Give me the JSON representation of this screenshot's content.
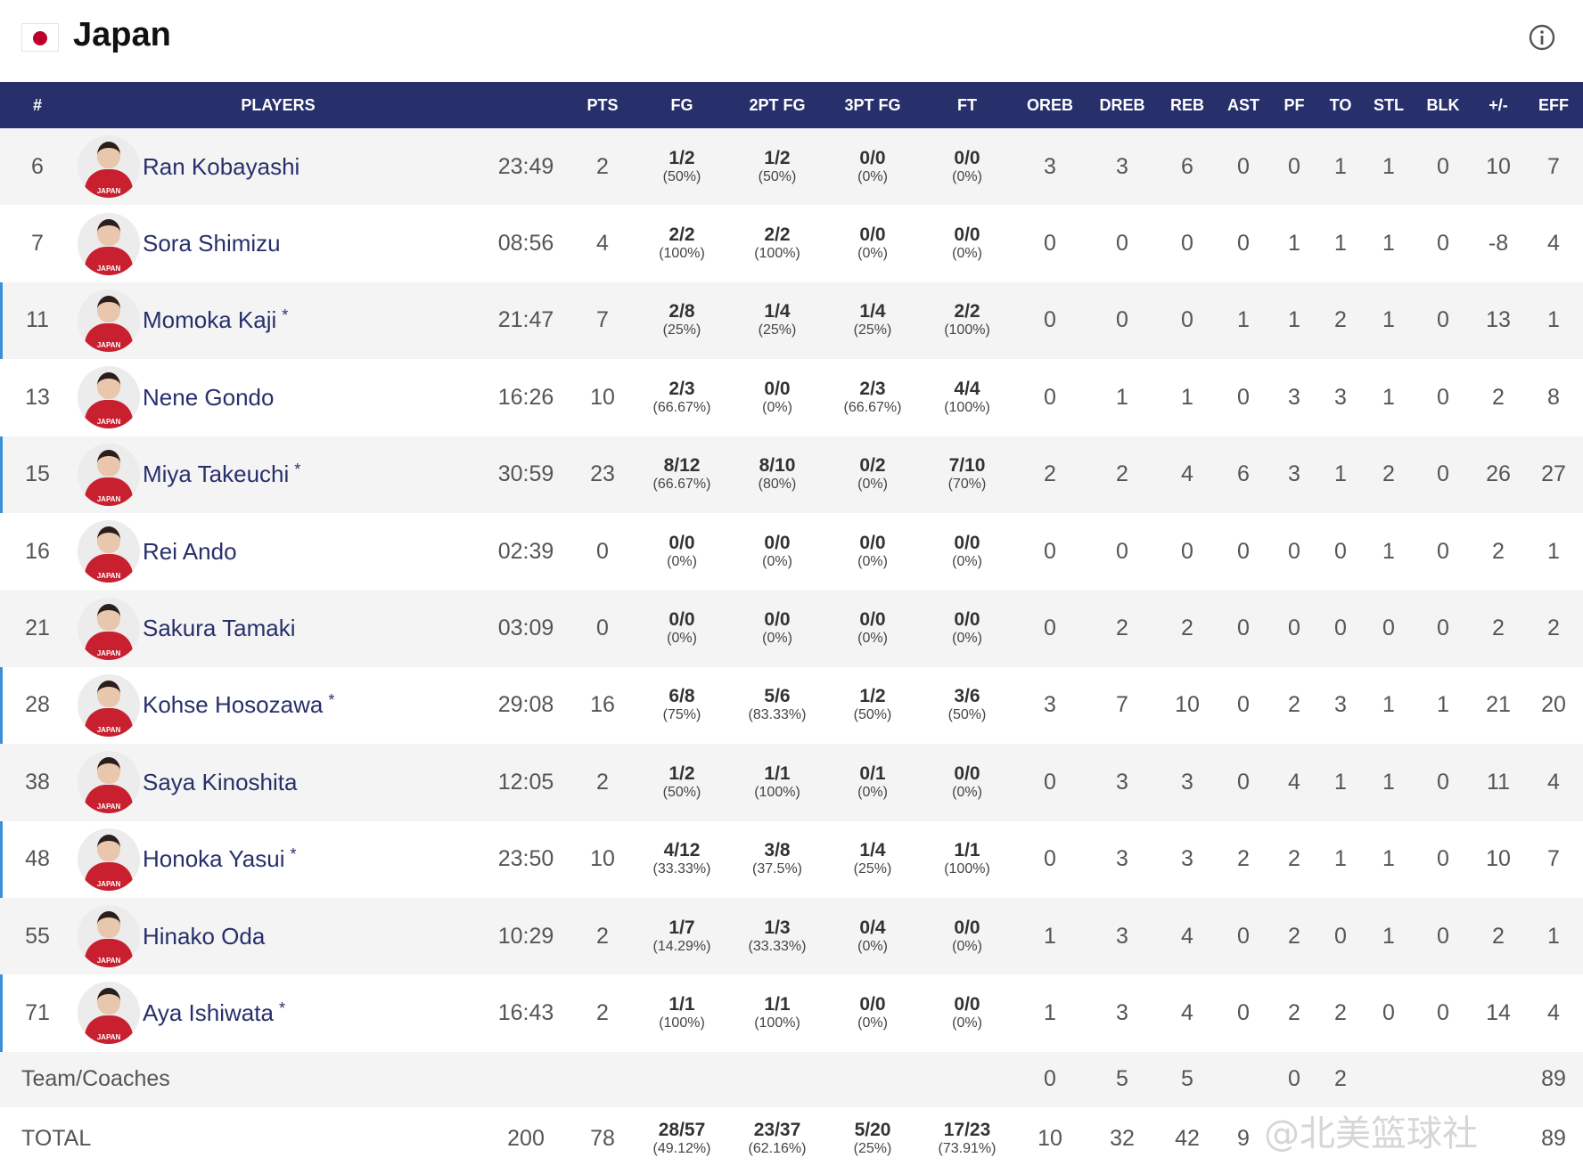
{
  "team": {
    "name": "Japan"
  },
  "header": [
    "#",
    "PLAYERS",
    "PTS",
    "FG",
    "2PT FG",
    "3PT FG",
    "FT",
    "OREB",
    "DREB",
    "REB",
    "AST",
    "PF",
    "TO",
    "STL",
    "BLK",
    "+/-",
    "EFF"
  ],
  "players": [
    {
      "num": "6",
      "name": "Ran Kobayashi",
      "starter": false,
      "min": "23:49",
      "pts": "2",
      "fg": "1/2",
      "fg_pct": "(50%)",
      "fg2": "1/2",
      "fg2_pct": "(50%)",
      "fg3": "0/0",
      "fg3_pct": "(0%)",
      "ft": "0/0",
      "ft_pct": "(0%)",
      "oreb": "3",
      "dreb": "3",
      "reb": "6",
      "ast": "0",
      "pf": "0",
      "to": "1",
      "stl": "1",
      "blk": "0",
      "pm": "10",
      "eff": "7"
    },
    {
      "num": "7",
      "name": "Sora Shimizu",
      "starter": false,
      "min": "08:56",
      "pts": "4",
      "fg": "2/2",
      "fg_pct": "(100%)",
      "fg2": "2/2",
      "fg2_pct": "(100%)",
      "fg3": "0/0",
      "fg3_pct": "(0%)",
      "ft": "0/0",
      "ft_pct": "(0%)",
      "oreb": "0",
      "dreb": "0",
      "reb": "0",
      "ast": "0",
      "pf": "1",
      "to": "1",
      "stl": "1",
      "blk": "0",
      "pm": "-8",
      "eff": "4"
    },
    {
      "num": "11",
      "name": "Momoka Kaji",
      "starter": true,
      "min": "21:47",
      "pts": "7",
      "fg": "2/8",
      "fg_pct": "(25%)",
      "fg2": "1/4",
      "fg2_pct": "(25%)",
      "fg3": "1/4",
      "fg3_pct": "(25%)",
      "ft": "2/2",
      "ft_pct": "(100%)",
      "oreb": "0",
      "dreb": "0",
      "reb": "0",
      "ast": "1",
      "pf": "1",
      "to": "2",
      "stl": "1",
      "blk": "0",
      "pm": "13",
      "eff": "1"
    },
    {
      "num": "13",
      "name": "Nene Gondo",
      "starter": false,
      "min": "16:26",
      "pts": "10",
      "fg": "2/3",
      "fg_pct": "(66.67%)",
      "fg2": "0/0",
      "fg2_pct": "(0%)",
      "fg3": "2/3",
      "fg3_pct": "(66.67%)",
      "ft": "4/4",
      "ft_pct": "(100%)",
      "oreb": "0",
      "dreb": "1",
      "reb": "1",
      "ast": "0",
      "pf": "3",
      "to": "3",
      "stl": "1",
      "blk": "0",
      "pm": "2",
      "eff": "8"
    },
    {
      "num": "15",
      "name": "Miya Takeuchi",
      "starter": true,
      "min": "30:59",
      "pts": "23",
      "fg": "8/12",
      "fg_pct": "(66.67%)",
      "fg2": "8/10",
      "fg2_pct": "(80%)",
      "fg3": "0/2",
      "fg3_pct": "(0%)",
      "ft": "7/10",
      "ft_pct": "(70%)",
      "oreb": "2",
      "dreb": "2",
      "reb": "4",
      "ast": "6",
      "pf": "3",
      "to": "1",
      "stl": "2",
      "blk": "0",
      "pm": "26",
      "eff": "27"
    },
    {
      "num": "16",
      "name": "Rei Ando",
      "starter": false,
      "min": "02:39",
      "pts": "0",
      "fg": "0/0",
      "fg_pct": "(0%)",
      "fg2": "0/0",
      "fg2_pct": "(0%)",
      "fg3": "0/0",
      "fg3_pct": "(0%)",
      "ft": "0/0",
      "ft_pct": "(0%)",
      "oreb": "0",
      "dreb": "0",
      "reb": "0",
      "ast": "0",
      "pf": "0",
      "to": "0",
      "stl": "1",
      "blk": "0",
      "pm": "2",
      "eff": "1"
    },
    {
      "num": "21",
      "name": "Sakura Tamaki",
      "starter": false,
      "min": "03:09",
      "pts": "0",
      "fg": "0/0",
      "fg_pct": "(0%)",
      "fg2": "0/0",
      "fg2_pct": "(0%)",
      "fg3": "0/0",
      "fg3_pct": "(0%)",
      "ft": "0/0",
      "ft_pct": "(0%)",
      "oreb": "0",
      "dreb": "2",
      "reb": "2",
      "ast": "0",
      "pf": "0",
      "to": "0",
      "stl": "0",
      "blk": "0",
      "pm": "2",
      "eff": "2"
    },
    {
      "num": "28",
      "name": "Kohse Hosozawa",
      "starter": true,
      "min": "29:08",
      "pts": "16",
      "fg": "6/8",
      "fg_pct": "(75%)",
      "fg2": "5/6",
      "fg2_pct": "(83.33%)",
      "fg3": "1/2",
      "fg3_pct": "(50%)",
      "ft": "3/6",
      "ft_pct": "(50%)",
      "oreb": "3",
      "dreb": "7",
      "reb": "10",
      "ast": "0",
      "pf": "2",
      "to": "3",
      "stl": "1",
      "blk": "1",
      "pm": "21",
      "eff": "20"
    },
    {
      "num": "38",
      "name": "Saya Kinoshita",
      "starter": false,
      "min": "12:05",
      "pts": "2",
      "fg": "1/2",
      "fg_pct": "(50%)",
      "fg2": "1/1",
      "fg2_pct": "(100%)",
      "fg3": "0/1",
      "fg3_pct": "(0%)",
      "ft": "0/0",
      "ft_pct": "(0%)",
      "oreb": "0",
      "dreb": "3",
      "reb": "3",
      "ast": "0",
      "pf": "4",
      "to": "1",
      "stl": "1",
      "blk": "0",
      "pm": "11",
      "eff": "4"
    },
    {
      "num": "48",
      "name": "Honoka Yasui",
      "starter": true,
      "min": "23:50",
      "pts": "10",
      "fg": "4/12",
      "fg_pct": "(33.33%)",
      "fg2": "3/8",
      "fg2_pct": "(37.5%)",
      "fg3": "1/4",
      "fg3_pct": "(25%)",
      "ft": "1/1",
      "ft_pct": "(100%)",
      "oreb": "0",
      "dreb": "3",
      "reb": "3",
      "ast": "2",
      "pf": "2",
      "to": "1",
      "stl": "1",
      "blk": "0",
      "pm": "10",
      "eff": "7"
    },
    {
      "num": "55",
      "name": "Hinako Oda",
      "starter": false,
      "min": "10:29",
      "pts": "2",
      "fg": "1/7",
      "fg_pct": "(14.29%)",
      "fg2": "1/3",
      "fg2_pct": "(33.33%)",
      "fg3": "0/4",
      "fg3_pct": "(0%)",
      "ft": "0/0",
      "ft_pct": "(0%)",
      "oreb": "1",
      "dreb": "3",
      "reb": "4",
      "ast": "0",
      "pf": "2",
      "to": "0",
      "stl": "1",
      "blk": "0",
      "pm": "2",
      "eff": "1"
    },
    {
      "num": "71",
      "name": "Aya Ishiwata",
      "starter": true,
      "min": "16:43",
      "pts": "2",
      "fg": "1/1",
      "fg_pct": "(100%)",
      "fg2": "1/1",
      "fg2_pct": "(100%)",
      "fg3": "0/0",
      "fg3_pct": "(0%)",
      "ft": "0/0",
      "ft_pct": "(0%)",
      "oreb": "1",
      "dreb": "3",
      "reb": "4",
      "ast": "0",
      "pf": "2",
      "to": "2",
      "stl": "0",
      "blk": "0",
      "pm": "14",
      "eff": "4"
    }
  ],
  "starter_mark": "*",
  "jersey_text": "JAPAN",
  "team_row": {
    "label": "Team/Coaches",
    "oreb": "0",
    "dreb": "5",
    "reb": "5",
    "pf": "0",
    "to": "2",
    "eff": "89"
  },
  "total_row": {
    "label": "TOTAL",
    "min": "200",
    "pts": "78",
    "fg": "28/57",
    "fg_pct": "(49.12%)",
    "fg2": "23/37",
    "fg2_pct": "(62.16%)",
    "fg3": "5/20",
    "fg3_pct": "(25%)",
    "ft": "17/23",
    "ft_pct": "(73.91%)",
    "oreb": "10",
    "dreb": "32",
    "reb": "42",
    "ast": "9",
    "eff": "89"
  },
  "watermark": "@北美篮球社",
  "colors": {
    "header_bg": "#27306b",
    "name_color": "#27306b",
    "starter_bar": "#3b8fd9",
    "flag_red": "#bc002d"
  },
  "icons": {
    "info": "info-circle-icon",
    "flag": "japan-flag-icon"
  }
}
